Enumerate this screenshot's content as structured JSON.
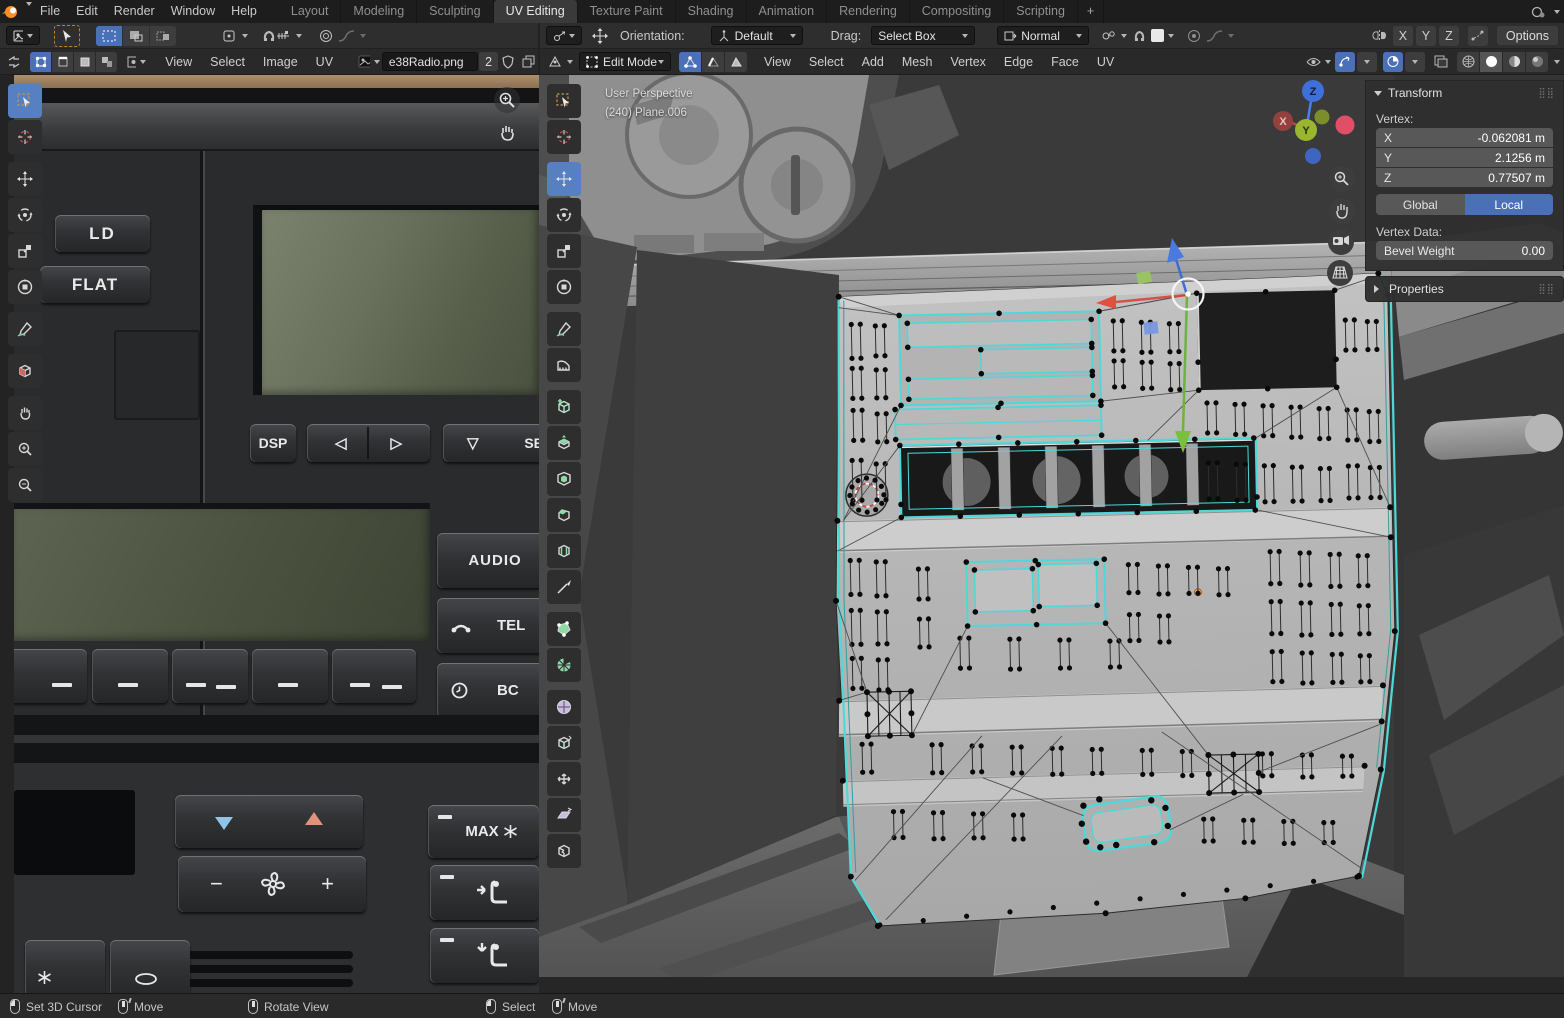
{
  "topbar": {
    "menus": [
      "File",
      "Edit",
      "Render",
      "Window",
      "Help"
    ],
    "tabs": [
      "Layout",
      "Modeling",
      "Sculpting",
      "UV Editing",
      "Texture Paint",
      "Shading",
      "Animation",
      "Rendering",
      "Compositing",
      "Scripting"
    ],
    "active_tab": "UV Editing",
    "plus_tab": "+"
  },
  "uv": {
    "menus": [
      "View",
      "Select",
      "Image",
      "UV"
    ],
    "image_name": "e38Radio.png",
    "users": "2",
    "toolbar": [
      "tweak",
      "cursor",
      "move",
      "rotate",
      "scale",
      "transform",
      "annotate",
      "sample",
      "pan",
      "zoom-in",
      "zoom-out"
    ]
  },
  "v3d": {
    "tool_settings": {
      "orientation_label": "Orientation:",
      "orientation_value": "Default",
      "drag_label": "Drag:",
      "drag_value": "Select Box",
      "normal_value": "Normal",
      "axis_x": "X",
      "axis_y": "Y",
      "axis_z": "Z",
      "options": "Options"
    },
    "header": {
      "mode": "Edit Mode",
      "menus": [
        "View",
        "Select",
        "Add",
        "Mesh",
        "Vertex",
        "Edge",
        "Face",
        "UV"
      ]
    },
    "overlay": {
      "line1": "User Perspective",
      "line2": "(240) Plane.006"
    },
    "axis_gizmo": {
      "x": "X",
      "y": "Y",
      "z": "Z"
    },
    "toolbar": [
      "tweak",
      "cursor",
      "move",
      "rotate",
      "scale",
      "transform",
      "annotate",
      "measure",
      "add-cube",
      "extrude",
      "inset",
      "bevel",
      "loop-cut",
      "knife",
      "poly-build",
      "spin",
      "smooth",
      "edge-slide",
      "shrink-fatten",
      "shear",
      "rip-region"
    ]
  },
  "npanel": {
    "transform_title": "Transform",
    "vertex_label": "Vertex:",
    "rows": [
      {
        "axis": "X",
        "value": "-0.062081 m"
      },
      {
        "axis": "Y",
        "value": "2.1256 m"
      },
      {
        "axis": "Z",
        "value": "0.77507 m"
      }
    ],
    "global_label": "Global",
    "local_label": "Local",
    "vertex_data_label": "Vertex Data:",
    "bevel_label": "Bevel Weight",
    "bevel_value": "0.00",
    "properties_title": "Properties"
  },
  "radio": {
    "ld": "LD",
    "flat": "FLAT",
    "dsp": "DSP",
    "prev": "◁",
    "next": "▷",
    "down": "▽",
    "se": "SE",
    "audio": "AUDIO",
    "tel": "TEL",
    "bc": "BC",
    "max": "MAX",
    "minus": "−",
    "plus": "+"
  },
  "statusbar": [
    {
      "button": "lmb",
      "label": "Set 3D Cursor"
    },
    {
      "button": "mmb",
      "label": "Move"
    },
    {
      "button": "mmb",
      "label": "Rotate View"
    },
    {
      "button": "lmb",
      "label": "Select"
    },
    {
      "button": "mmb",
      "label": "Move"
    }
  ],
  "colors": {
    "accent": "#4a71b8",
    "selection_edge": "#4fd8d8",
    "gizmo_x": "#d8453a",
    "gizmo_y": "#6fb33c",
    "gizmo_z": "#3d6ed8",
    "origin": "#e8923f"
  }
}
